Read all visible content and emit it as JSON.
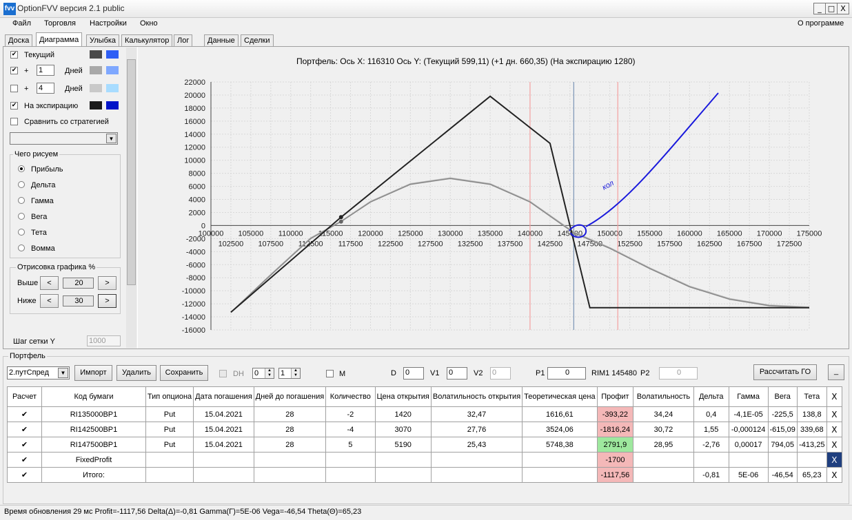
{
  "window": {
    "title": "OptionFVV версия 2.1 public",
    "icon": "optionfvv-app-icon",
    "icon_text": "fvv",
    "controls": [
      "_",
      "□",
      "X"
    ]
  },
  "menu": {
    "items": [
      "Файл",
      "Торговля",
      "Настройки",
      "Окно"
    ],
    "about": "О программе"
  },
  "tabs": [
    "Доска",
    "Диаграмма",
    "Улыбка",
    "Калькулятор",
    "Лог",
    "Данные",
    "Сделки"
  ],
  "active_tab": "Диаграмма",
  "left_panel": {
    "current": {
      "label": "Текущий",
      "checked": true,
      "colors": [
        "#4a4a4a",
        "#2f5ff5"
      ]
    },
    "plus1": {
      "prefix": "+",
      "value": "1",
      "unit": "Дней",
      "checked": true,
      "colors": [
        "#a8a8a8",
        "#7fa8ff"
      ]
    },
    "plus4": {
      "prefix": "+",
      "value": "4",
      "unit": "Дней",
      "checked": false,
      "colors": [
        "#c9c9c9",
        "#a8dcff"
      ]
    },
    "expiry": {
      "label": "На экспирацию",
      "checked": true,
      "colors": [
        "#1a1a1a",
        "#0014c8"
      ]
    },
    "compare": {
      "label": "Сравнить со стратегией",
      "checked": false
    },
    "strategy_select": "",
    "draw_group": {
      "title": "Чего рисуем",
      "options": [
        "Прибыль",
        "Дельта",
        "Гамма",
        "Вега",
        "Тета",
        "Вомма"
      ],
      "selected": "Прибыль"
    },
    "percent_group": {
      "title": "Отрисовка графика %",
      "above_label": "Выше",
      "above_value": "20",
      "below_label": "Ниже",
      "below_value": "30",
      "left_btn": "<",
      "right_btn": ">"
    },
    "grid_step": {
      "label": "Шаг сетки Y",
      "value": "1000"
    }
  },
  "chart_data": {
    "type": "line",
    "title_parts": {
      "prefix": "Портфель:",
      "xaxis": "Ось X:",
      "x_value": "116310",
      "yaxis": "Ось Y:",
      "current": "(Текущий 599,11)",
      "plus1": "(+1 дн. 660,35)",
      "expiry": "(На экспирацию 1280)"
    },
    "xlim": [
      100000,
      175000
    ],
    "ylim": [
      -16000,
      22000
    ],
    "x_ticks_upper": [
      "100000",
      "105000",
      "110000",
      "115000",
      "120000",
      "125000",
      "130000",
      "135000",
      "140000",
      "145000",
      "150000",
      "155000",
      "160000",
      "165000",
      "170000",
      "175000"
    ],
    "x_ticks_lower": [
      "102500",
      "107500",
      "112500",
      "117500",
      "122500",
      "127500",
      "132500",
      "137500",
      "142500",
      "147500",
      "152500",
      "157500",
      "162500",
      "167500",
      "172500"
    ],
    "y_ticks": [
      "22000",
      "20000",
      "18000",
      "16000",
      "14000",
      "12000",
      "10000",
      "8000",
      "6000",
      "4000",
      "2000",
      "0",
      "-2000",
      "-4000",
      "-6000",
      "-8000",
      "-10000",
      "-12000",
      "-14000",
      "-16000"
    ],
    "grid": true,
    "vertical_lines": [
      {
        "x": 140000,
        "color": "#f4a0a0"
      },
      {
        "x": 145480,
        "color": "#7a95b5"
      },
      {
        "x": 151000,
        "color": "#f4a0a0"
      }
    ],
    "series": [
      {
        "color": "#222222",
        "points": [
          [
            102500,
            -13300
          ],
          [
            116310,
            1280
          ],
          [
            135000,
            19800
          ],
          [
            142500,
            12600
          ],
          [
            147500,
            -12600
          ],
          [
            175000,
            -12600
          ]
        ]
      },
      {
        "color": "#8a8a8a",
        "points": [
          [
            102500,
            -13300
          ],
          [
            107500,
            -7600
          ],
          [
            112500,
            -2000
          ],
          [
            116310,
            599
          ],
          [
            120000,
            3600
          ],
          [
            125000,
            6300
          ],
          [
            130000,
            7200
          ],
          [
            135000,
            6300
          ],
          [
            140000,
            3600
          ],
          [
            145480,
            -1117
          ],
          [
            150000,
            -3500
          ],
          [
            155000,
            -6600
          ],
          [
            160000,
            -9400
          ],
          [
            165000,
            -11300
          ],
          [
            170000,
            -12300
          ],
          [
            175000,
            -12600
          ]
        ]
      },
      {
        "color": "#b8b8b8",
        "points": [
          [
            102500,
            -13300
          ],
          [
            107500,
            -7500
          ],
          [
            112500,
            -1900
          ],
          [
            116310,
            660
          ],
          [
            120000,
            3700
          ],
          [
            125000,
            6400
          ],
          [
            130000,
            7300
          ],
          [
            135000,
            6400
          ],
          [
            140000,
            3700
          ],
          [
            145480,
            -1000
          ],
          [
            150000,
            -3400
          ],
          [
            155000,
            -6500
          ],
          [
            160000,
            -9300
          ],
          [
            165000,
            -11200
          ],
          [
            170000,
            -12200
          ],
          [
            175000,
            -12500
          ]
        ]
      }
    ],
    "markers": [
      {
        "x": 116310,
        "y": 1280,
        "color": "#222222"
      },
      {
        "x": 116310,
        "y": 599,
        "color": "#666666"
      }
    ],
    "annotation": {
      "text": "кол",
      "color": "#1a1adc"
    }
  },
  "portfolio": {
    "title": "Портфель",
    "select_value": "2.путСпред",
    "buttons": {
      "import": "Импорт",
      "delete": "Удалить",
      "save": "Сохранить",
      "calc": "Рассчитать ГО",
      "minimize": "_"
    },
    "dh": {
      "label": "DH",
      "v1": "0",
      "v2": "1"
    },
    "m": {
      "label": "M"
    },
    "d": {
      "label": "D",
      "value": "0"
    },
    "v1": {
      "label": "V1",
      "value": "0"
    },
    "v2": {
      "label": "V2",
      "value": "0"
    },
    "p1": {
      "label": "P1",
      "value": "0"
    },
    "base": "RIM1 145480",
    "p2": {
      "label": "P2",
      "value": "0"
    },
    "columns": [
      "Расчет",
      "Код бумаги",
      "Тип опциона",
      "Дата погашения",
      "Дней до погашения",
      "Количество",
      "Цена открытия",
      "Волатильность открытия",
      "Теоретическая цена",
      "Профит",
      "Волатильность",
      "Дельта",
      "Гамма",
      "Вега",
      "Тета",
      "X"
    ],
    "rows": [
      {
        "check": "✔",
        "code": "RI135000BP1",
        "type": "Put",
        "date": "15.04.2021",
        "days": "28",
        "qty": "-2",
        "open": "1420",
        "vol_open": "32,47",
        "theo": "1616,61",
        "profit": "-393,22",
        "profit_color": "red",
        "vol": "34,24",
        "delta": "0,4",
        "gamma": "-4,1E-05",
        "vega": "-225,5",
        "theta": "138,8",
        "x": "X"
      },
      {
        "check": "✔",
        "code": "RI142500BP1",
        "type": "Put",
        "date": "15.04.2021",
        "days": "28",
        "qty": "-4",
        "open": "3070",
        "vol_open": "27,76",
        "theo": "3524,06",
        "profit": "-1816,24",
        "profit_color": "red",
        "vol": "30,72",
        "delta": "1,55",
        "gamma": "-0,000124",
        "vega": "-615,09",
        "theta": "339,68",
        "x": "X"
      },
      {
        "check": "✔",
        "code": "RI147500BP1",
        "type": "Put",
        "date": "15.04.2021",
        "days": "28",
        "qty": "5",
        "open": "5190",
        "vol_open": "25,43",
        "theo": "5748,38",
        "profit": "2791,9",
        "profit_color": "green",
        "vol": "28,95",
        "delta": "-2,76",
        "gamma": "0,00017",
        "vega": "794,05",
        "theta": "-413,25",
        "x": "X"
      },
      {
        "check": "✔",
        "code": "FixedProfit",
        "type": "",
        "date": "",
        "days": "",
        "qty": "",
        "open": "",
        "vol_open": "",
        "theo": "",
        "profit": "-1700",
        "profit_color": "red",
        "vol": "",
        "delta": "",
        "gamma": "",
        "vega": "",
        "theta": "",
        "x": "X"
      },
      {
        "check": "✔",
        "code": "Итого:",
        "type": "",
        "date": "",
        "days": "",
        "qty": "",
        "open": "",
        "vol_open": "",
        "theo": "",
        "profit": "-1117,56",
        "profit_color": "red",
        "vol": "",
        "delta": "-0,81",
        "gamma": "5E-06",
        "vega": "-46,54",
        "theta": "65,23",
        "x": "X"
      }
    ]
  },
  "status": "Время обновления 29 мс  Profit=-1117,56 Delta(Δ)=-0,81 Gamma(Γ)=5E-06 Vega=-46,54 Theta(Θ)=65,23"
}
